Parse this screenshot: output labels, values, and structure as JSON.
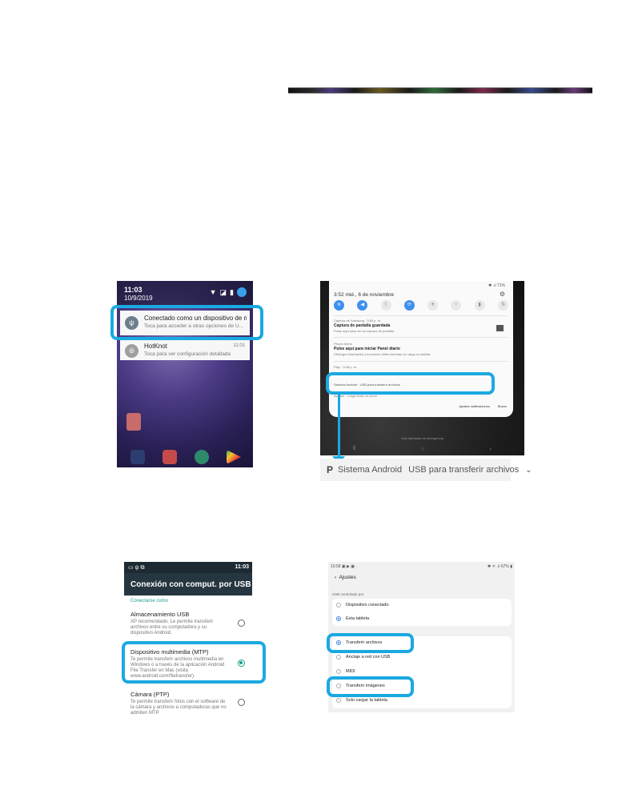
{
  "panel1": {
    "status": {
      "time": "11:03",
      "date": "10/9/2019"
    },
    "notifications": [
      {
        "title": "Conectado como un dispositivo de m...",
        "subtitle": "Toca para acceder a otras opciones de U...",
        "time": ""
      },
      {
        "title": "HotKnot",
        "subtitle": "Toca para ver configuración detallada",
        "time": "11:01"
      }
    ]
  },
  "panel2": {
    "status_right": "✱ .ıl 71%",
    "datetime": "3:52  mié., 6 de noviembre",
    "notifications": [
      {
        "app": "Captura de Samsung · 3:50 p. m.",
        "title": "Captura de pantalla guardada",
        "body": "Pulse aquí para ver su captura de pantalla."
      },
      {
        "app": "Phone Alerts",
        "title": "Pulse aquí para iniciar Panel diario",
        "body": "Obtenga información y funciones útiles mientras se carga su tableta."
      },
      {
        "app": "Play · 3:48 p. m.",
        "title": "",
        "body": ""
      },
      {
        "app": "Sistema Android · USB para transferir archivos",
        "title": "",
        "body": ""
      },
      {
        "app": "Ajustes · Carga lenta en curso",
        "title": "",
        "body": ""
      }
    ],
    "buttons": {
      "notif_settings": "Ajustes notificaciones",
      "clear": "Borrar"
    },
    "emergency": "Solo llamadas de emergencia"
  },
  "zoom_strip": {
    "app": "Sistema Android",
    "text": "USB para transferir archivos"
  },
  "panel3": {
    "status_time": "11:03",
    "title": "Conexión con comput. por USB",
    "section": "Conectarse como",
    "options": [
      {
        "title": "Almacenamiento USB",
        "desc": "XP recomendado. Le permite transferir archivos entre su computadora y su dispositivo Android."
      },
      {
        "title": "Dispositivo multimedia (MTP)",
        "desc": "Te permite transferir archivos multimedia en Windows o a través de la aplicación Android File Transfer en Mac (visita www.android.com/filetransfer)."
      },
      {
        "title": "Cámara (PTP)",
        "desc": "Te permite transferir fotos con el software de la cámara y archivos a computadoras que no admiten MTP"
      }
    ],
    "selected_option": 1
  },
  "panel4": {
    "status_left": "10:58 ▣ ▶ ▣ ·",
    "status_right": "✱ ᯤ .ıl 67% ▮",
    "back_label": "Ajustes",
    "group_label": "USB controlado por",
    "controlled_by": [
      "Dispositivo conectado",
      "Esta tableta"
    ],
    "controlled_selected": 1,
    "usb_for": [
      "Transferir archivos",
      "Anclaje a red con USB",
      "MIDI",
      "Transferir imágenes",
      "Solo cargar la tableta"
    ],
    "usb_selected": 0
  },
  "colors": {
    "highlight": "#1ba9e1",
    "teal": "#1a9c8c",
    "samsung_blue": "#3d7fe0"
  }
}
